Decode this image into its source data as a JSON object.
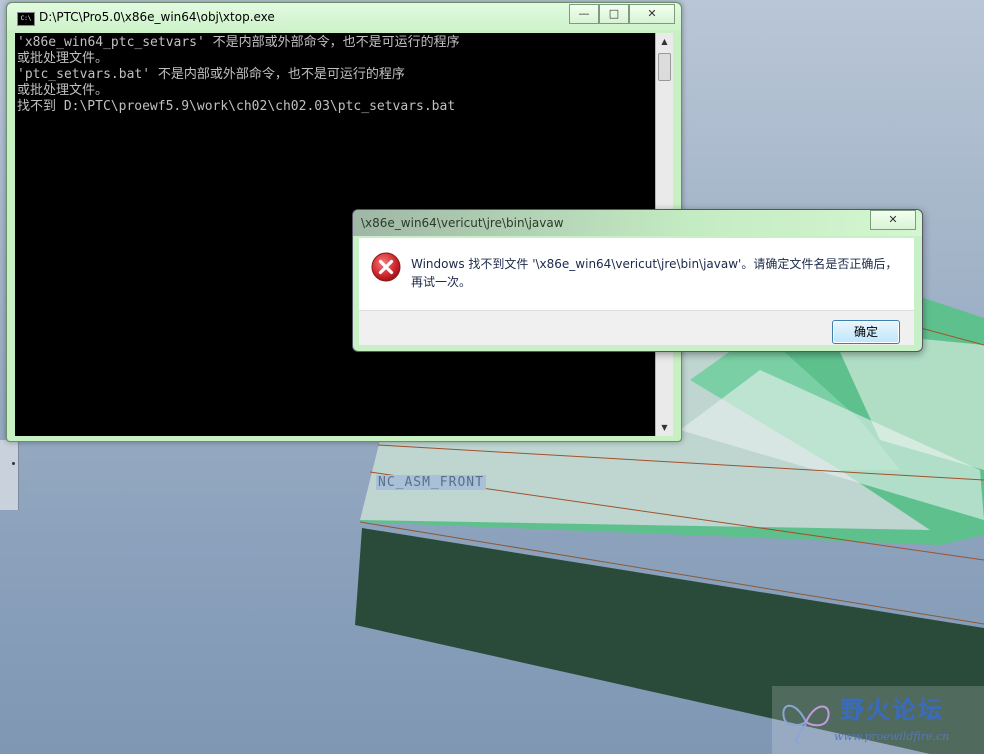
{
  "console": {
    "title": "D:\\PTC\\Pro5.0\\x86e_win64\\obj\\xtop.exe",
    "icon_text": "C:\\",
    "output": "'x86e_win64_ptc_setvars' 不是内部或外部命令，也不是可运行的程序\n或批处理文件。\n'ptc_setvars.bat' 不是内部或外部命令，也不是可运行的程序\n或批处理文件。\n找不到 D:\\PTC\\proewf5.9\\work\\ch02\\ch02.03\\ptc_setvars.bat",
    "minimize": "—",
    "maximize": "□",
    "close": "✕"
  },
  "dialog": {
    "title": "\\x86e_win64\\vericut\\jre\\bin\\javaw",
    "message": "Windows 找不到文件 '\\x86e_win64\\vericut\\jre\\bin\\javaw'。请确定文件名是否正确后，再试一次。",
    "ok_label": "确定",
    "close": "✕",
    "icon": "error-icon"
  },
  "viewport": {
    "datum_label": "NC_ASM_FRONT"
  },
  "watermark": {
    "title": "野火论坛",
    "url": "www.proewildfire.cn"
  },
  "colors": {
    "model_top": "#5fbf8c",
    "model_side": "#2c4a3c",
    "error_red": "#d0262b"
  }
}
